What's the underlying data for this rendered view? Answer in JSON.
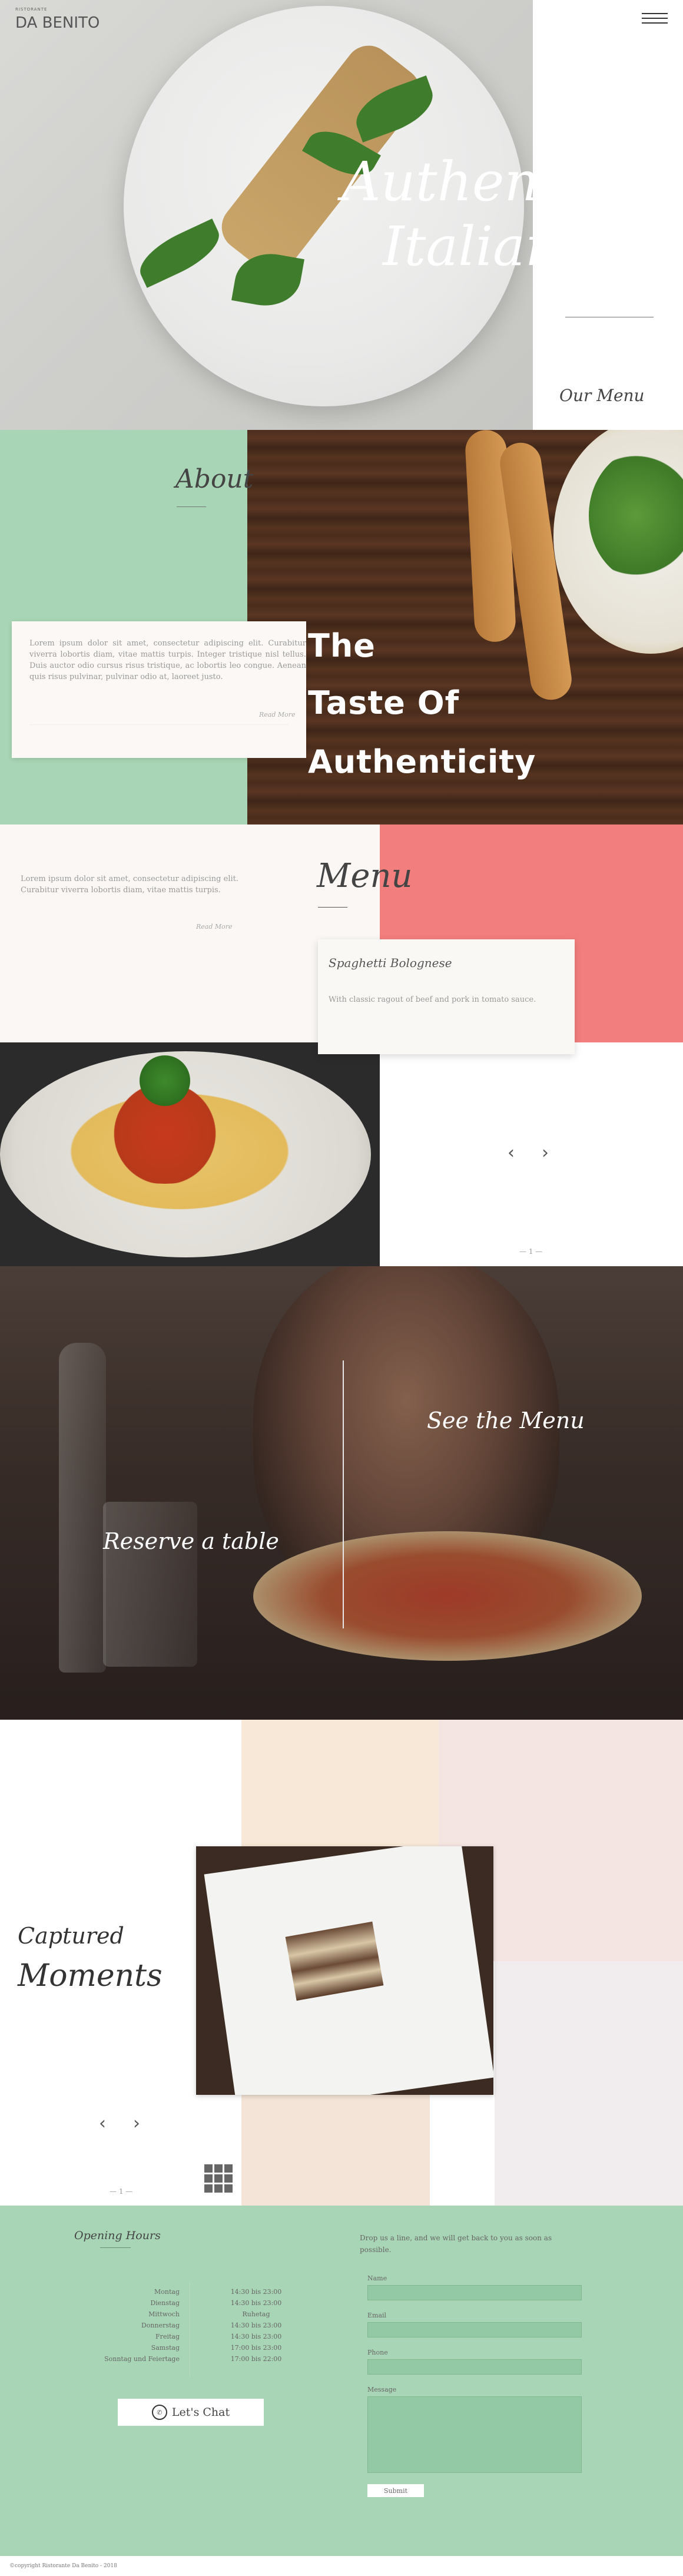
{
  "header": {
    "logo_small": "RISTORANTE",
    "logo": "DA BENITO",
    "menu_icon": "hamburger-icon"
  },
  "hero": {
    "title_line1": "Authentic",
    "title_line2": "Italian",
    "our_menu_link": "Our Menu"
  },
  "about": {
    "title": "About",
    "text": "Lorem ipsum dolor sit amet, consectetur adipiscing elit. Curabitur viverra lobortis diam, vitae mattis turpis. Integer tristique nisl tellus. Duis auctor odio cursus risus tristique, ac lobortis leo congue. Aenean quis risus pulvinar, pulvinar odio at, laoreet justo.",
    "read_more": "Read More",
    "tagline_1": "The",
    "tagline_2": "Taste Of",
    "tagline_3": "Authenticity"
  },
  "menu": {
    "intro_text": "Lorem ipsum dolor sit amet, consectetur adipiscing elit. Curabitur viverra lobortis diam, vitae mattis turpis.",
    "read_more": "Read More",
    "title": "Menu",
    "dish_name": "Spaghetti Bolognese",
    "dish_desc": "With classic ragout of beef and pork in tomato sauce.",
    "prev_icon": "chevron-left-icon",
    "next_icon": "chevron-right-icon",
    "prev": "‹",
    "next": "›",
    "pagination": "— 1 —"
  },
  "dining": {
    "see_menu": "See the Menu",
    "reserve": "Reserve a table"
  },
  "gallery": {
    "title_1": "Captured",
    "title_2": "Moments",
    "prev": "‹",
    "next": "›",
    "pagination": "— 1 —",
    "grid_icon": "grid-icon"
  },
  "footer": {
    "hours_title": "Opening Hours",
    "hours": [
      {
        "day": "Montag",
        "time": "14:30 bis 23:00"
      },
      {
        "day": "Dienstag",
        "time": "14:30 bis 23:00"
      },
      {
        "day": "Mittwoch",
        "time": "Ruhetag"
      },
      {
        "day": "Donnerstag",
        "time": "14:30 bis 23:00"
      },
      {
        "day": "Freitag",
        "time": "14:30 bis 23:00"
      },
      {
        "day": "Samstag",
        "time": "17:00 bis 23:00"
      },
      {
        "day": "Sonntag und Feiertage",
        "time": "17:00 bis 22:00"
      }
    ],
    "chat_label": "Let's Chat",
    "contact_intro": "Drop us a line, and we will get back to you as soon as possible.",
    "form": {
      "name_label": "Name",
      "email_label": "Email",
      "phone_label": "Phone",
      "message_label": "Message",
      "submit": "Submit"
    },
    "copyright": "©copyright Ristorante Da Benito - 2018"
  },
  "colors": {
    "mint": "#a8d5b5",
    "coral": "#f27e7d",
    "cream": "#faf7f4"
  }
}
